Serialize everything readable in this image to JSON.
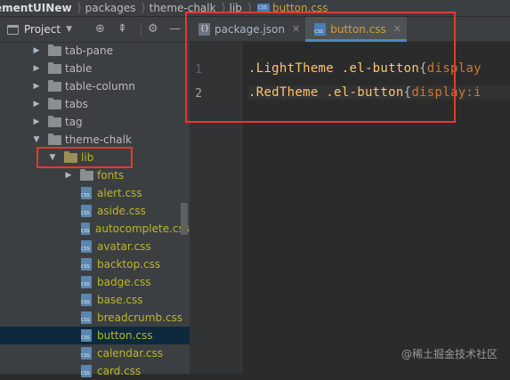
{
  "breadcrumb": {
    "items": [
      {
        "label": "ementUINew"
      },
      {
        "label": "packages"
      },
      {
        "label": "theme-chalk"
      },
      {
        "label": "lib"
      },
      {
        "label": "button.css",
        "icon": "css-file-icon"
      }
    ]
  },
  "project_panel": {
    "title": "Project",
    "toolbar_icons": [
      "target-icon",
      "collapse-icon",
      "gear-icon",
      "hide-icon"
    ]
  },
  "tree": [
    {
      "label": "tab-pane",
      "type": "folder",
      "expanded": false
    },
    {
      "label": "table",
      "type": "folder",
      "expanded": false
    },
    {
      "label": "table-column",
      "type": "folder",
      "expanded": false
    },
    {
      "label": "tabs",
      "type": "folder",
      "expanded": false
    },
    {
      "label": "tag",
      "type": "folder",
      "expanded": false
    },
    {
      "label": "theme-chalk",
      "type": "folder",
      "expanded": true
    },
    {
      "label": "lib",
      "type": "folder",
      "expanded": true
    },
    {
      "label": "fonts",
      "type": "folder",
      "expanded": false
    },
    {
      "label": "alert.css",
      "type": "file"
    },
    {
      "label": "aside.css",
      "type": "file"
    },
    {
      "label": "autocomplete.css",
      "type": "file"
    },
    {
      "label": "avatar.css",
      "type": "file"
    },
    {
      "label": "backtop.css",
      "type": "file"
    },
    {
      "label": "badge.css",
      "type": "file"
    },
    {
      "label": "base.css",
      "type": "file"
    },
    {
      "label": "breadcrumb.css",
      "type": "file"
    },
    {
      "label": "button.css",
      "type": "file",
      "selected": true
    },
    {
      "label": "calendar.css",
      "type": "file"
    },
    {
      "label": "card.css",
      "type": "file"
    }
  ],
  "editor": {
    "tabs": [
      {
        "label": "package.json",
        "active": false
      },
      {
        "label": "button.css",
        "active": true
      }
    ],
    "lines": [
      {
        "number": "1",
        "selector_a": ".LightTheme",
        "selector_b": ".el-button",
        "brace": "{",
        "prop": "display"
      },
      {
        "number": "2",
        "selector_a": ".RedTheme",
        "selector_b": ".el-button",
        "brace": "{",
        "prop": "display:i"
      }
    ]
  },
  "colors": {
    "annotation": "#e33a2f",
    "selector": "#ffc66d",
    "keyword": "#cc7832",
    "active_tab_text": "#c9a23c",
    "folder_label_highlight": "#bbb529"
  },
  "watermark": "@稀土掘金技术社区"
}
